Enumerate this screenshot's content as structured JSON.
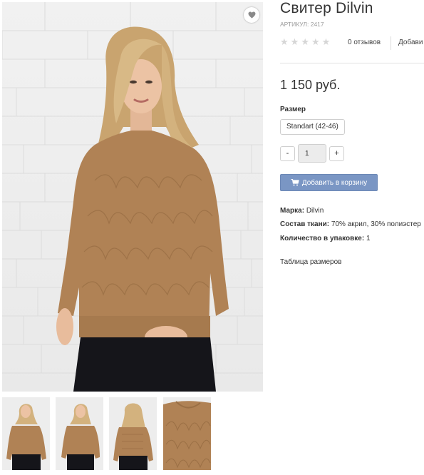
{
  "product": {
    "title": "Свитер Dilvin",
    "article": "АРТИКУЛ: 2417",
    "rating_stars": 0,
    "rating_max": 5,
    "reviews_label": "0 отзывов",
    "add_review_label": "Добави",
    "price": "1 150 руб."
  },
  "size": {
    "label": "Размер",
    "selected": "Standart (42-46)"
  },
  "quantity": {
    "minus_label": "-",
    "value": "1",
    "plus_label": "+"
  },
  "cart": {
    "button_label": "Добавить в корзину",
    "icon": "cart-icon"
  },
  "properties": [
    {
      "name": "Марка:",
      "value": "Dilvin"
    },
    {
      "name": "Состав ткани:",
      "value": "70% акрил, 30% полиэстер"
    },
    {
      "name": "Количество в упаковке:",
      "value": "1"
    }
  ],
  "size_table_link": "Таблица размеров",
  "gallery": {
    "favorite_icon": "heart-icon",
    "thumbnail_count": 4
  },
  "colors": {
    "sweater": "#b08255",
    "jeans": "#15151a",
    "hair": "#d3b27e",
    "accent_button": "#7a96c4",
    "star_empty": "#d6d6d6"
  }
}
